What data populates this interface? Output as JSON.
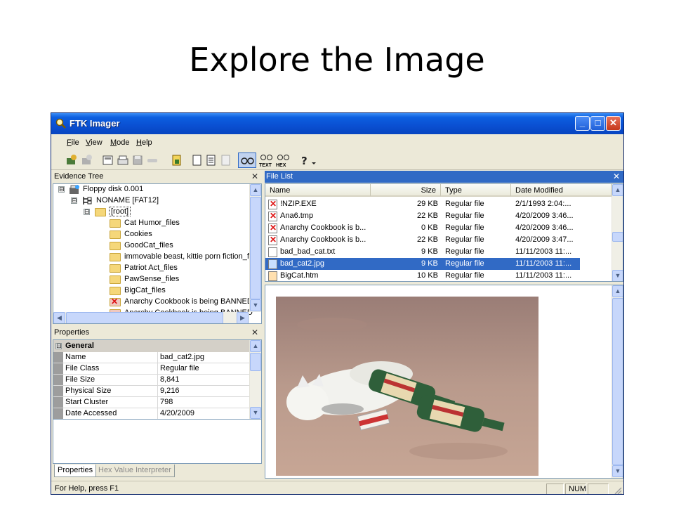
{
  "slide": {
    "title": "Explore the Image"
  },
  "window": {
    "title": "FTK Imager",
    "minimize": "_",
    "maximize": "□",
    "close": "✕"
  },
  "menu": [
    {
      "label": "File",
      "key": "F",
      "rest": "ile"
    },
    {
      "label": "View",
      "key": "V",
      "rest": "iew"
    },
    {
      "label": "Mode",
      "key": "M",
      "rest": "ode"
    },
    {
      "label": "Help",
      "key": "H",
      "rest": "elp"
    }
  ],
  "toolbar": {
    "text_label": "TEXT",
    "hex_label": "HEX"
  },
  "evidence_tree": {
    "title": "Evidence Tree",
    "items": [
      {
        "label": "Floppy disk 0.001",
        "expander": "⊟",
        "level": 0,
        "icon": "disk-icon"
      },
      {
        "label": "NONAME [FAT12]",
        "expander": "⊟",
        "level": 1,
        "icon": "partition-icon"
      },
      {
        "label": "[root]",
        "expander": "⊟",
        "level": 2,
        "icon": "folder-icon"
      },
      {
        "label": "Cat Humor_files",
        "level": 3,
        "icon": "folder-icon"
      },
      {
        "label": "Cookies",
        "level": 3,
        "icon": "folder-icon"
      },
      {
        "label": "GoodCat_files",
        "level": 3,
        "icon": "folder-icon"
      },
      {
        "label": "immovable beast, kittie porn fiction_file",
        "level": 3,
        "icon": "folder-icon"
      },
      {
        "label": "Patriot Act_files",
        "level": 3,
        "icon": "folder-icon"
      },
      {
        "label": "PawSense_files",
        "level": 3,
        "icon": "folder-icon"
      },
      {
        "label": "BigCat_files",
        "level": 3,
        "icon": "folder-icon"
      },
      {
        "label": "Anarchy Cookbook is being BANNED",
        "level": 3,
        "icon": "deleted-folder-icon"
      },
      {
        "label": "Anarchy Cookbook is being BANNED",
        "level": 3,
        "icon": "deleted-folder-icon"
      }
    ]
  },
  "file_list": {
    "title": "File List",
    "columns": [
      "Name",
      "Size",
      "Type",
      "Date Modified"
    ],
    "rows": [
      {
        "name": "!NZIP.EXE",
        "size": "29 KB",
        "type": "Regular file",
        "date": "2/1/1993 2:04:...",
        "deleted": true
      },
      {
        "name": "Ana6.tmp",
        "size": "22 KB",
        "type": "Regular file",
        "date": "4/20/2009 3:46...",
        "deleted": true
      },
      {
        "name": "Anarchy Cookbook is b...",
        "size": "0 KB",
        "type": "Regular file",
        "date": "4/20/2009 3:46...",
        "deleted": true
      },
      {
        "name": "Anarchy Cookbook is b...",
        "size": "22 KB",
        "type": "Regular file",
        "date": "4/20/2009 3:47...",
        "deleted": true
      },
      {
        "name": "bad_bad_cat.txt",
        "size": "9 KB",
        "type": "Regular file",
        "date": "11/11/2003 11:...",
        "deleted": false
      },
      {
        "name": "bad_cat2.jpg",
        "size": "9 KB",
        "type": "Regular file",
        "date": "11/11/2003 11:...",
        "deleted": false,
        "selected": true
      },
      {
        "name": "BigCat.htm",
        "size": "10 KB",
        "type": "Regular file",
        "date": "11/11/2003 11:...",
        "deleted": false
      }
    ]
  },
  "properties": {
    "title": "Properties",
    "group": "General",
    "group_expander": "⊟",
    "rows": [
      {
        "key": "Name",
        "value": "bad_cat2.jpg"
      },
      {
        "key": "File Class",
        "value": "Regular file"
      },
      {
        "key": "File Size",
        "value": "8,841"
      },
      {
        "key": "Physical Size",
        "value": "9,216"
      },
      {
        "key": "Start Cluster",
        "value": "798"
      },
      {
        "key": "Date Accessed",
        "value": "4/20/2009"
      }
    ]
  },
  "tabs": [
    {
      "label": "Properties",
      "active": true
    },
    {
      "label": "Hex Value Interpreter",
      "active": false
    }
  ],
  "statusbar": {
    "help": "For Help, press F1",
    "num": "NUM"
  },
  "colors": {
    "titlebar": "#0a4fd2",
    "selection": "#316ac5",
    "chrome": "#ece9d8"
  }
}
